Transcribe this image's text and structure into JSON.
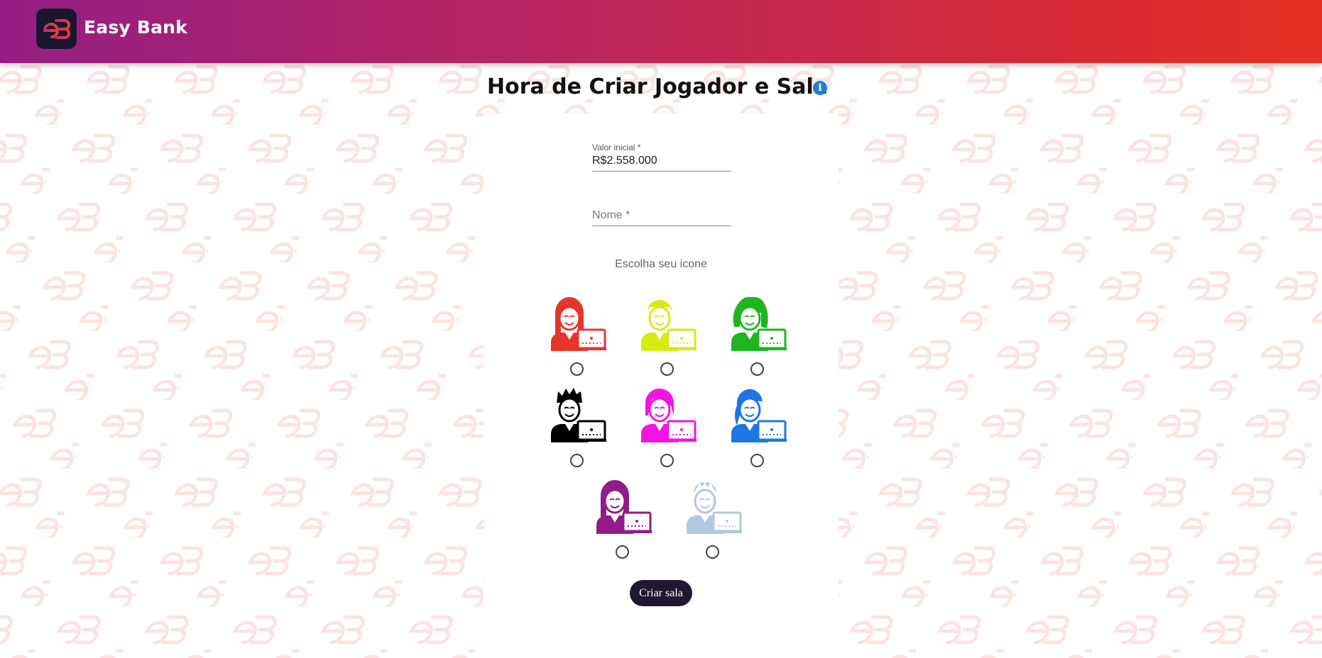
{
  "header": {
    "brand": "Easy Bank",
    "logo_icon": "eb-logo-icon",
    "gradient": [
      "#951f84",
      "#e63024"
    ]
  },
  "page": {
    "title": "Hora de Criar Jogador e Sala",
    "info_icon": "info-icon"
  },
  "form": {
    "initial_value_label": "Valor inicial *",
    "initial_value": "R$2.558.000",
    "name_placeholder": "Nome *",
    "name_value": "",
    "choose_icon_label": "Escolha seu icone",
    "submit_label": "Criar sala"
  },
  "avatars": [
    {
      "name": "red-woman-avatar-icon",
      "color": "#e8352c"
    },
    {
      "name": "lime-man-avatar-icon",
      "color": "#d8ea12"
    },
    {
      "name": "green-curly-woman-avatar-icon",
      "color": "#1fb51f"
    },
    {
      "name": "black-man-avatar-icon",
      "color": "#000000"
    },
    {
      "name": "magenta-woman-avatar-icon",
      "color": "#f214e0"
    },
    {
      "name": "blue-woman-avatar-icon",
      "color": "#1f74e6"
    },
    {
      "name": "purple-woman-avatar-icon",
      "color": "#8f1c88"
    },
    {
      "name": "lightblue-man-avatar-icon",
      "color": "#b3c6e2"
    }
  ]
}
